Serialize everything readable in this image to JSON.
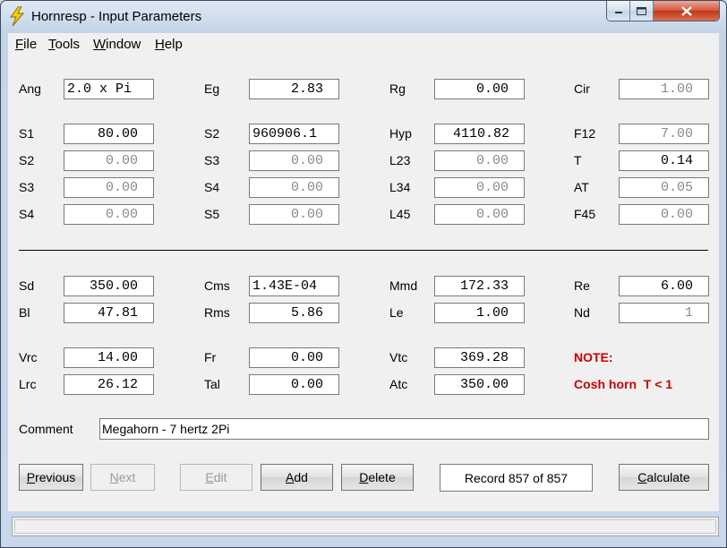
{
  "window": {
    "title": "Hornresp - Input Parameters",
    "accent": "#c8d7ea",
    "close_color": "#c2361a"
  },
  "menu": [
    {
      "acc": "F",
      "rest": "ile"
    },
    {
      "acc": "T",
      "rest": "ools"
    },
    {
      "acc": "W",
      "rest": "indow"
    },
    {
      "acc": "H",
      "rest": "elp"
    }
  ],
  "params": {
    "ang": {
      "label": "Ang",
      "value": "2.0 x Pi"
    },
    "eg": {
      "label": "Eg",
      "value": "2.83"
    },
    "rg": {
      "label": "Rg",
      "value": "0.00"
    },
    "cir": {
      "label": "Cir",
      "value": "1.00"
    },
    "s1": {
      "label": "S1",
      "value": "80.00"
    },
    "s2a": {
      "label": "S2",
      "value": "960906.1"
    },
    "hyp": {
      "label": "Hyp",
      "value": "4110.82"
    },
    "f12": {
      "label": "F12",
      "value": "7.00"
    },
    "s2b": {
      "label": "S2",
      "value": "0.00"
    },
    "s3a": {
      "label": "S3",
      "value": "0.00"
    },
    "l23": {
      "label": "L23",
      "value": "0.00"
    },
    "t": {
      "label": "T",
      "value": "0.14"
    },
    "s3b": {
      "label": "S3",
      "value": "0.00"
    },
    "s4a": {
      "label": "S4",
      "value": "0.00"
    },
    "l34": {
      "label": "L34",
      "value": "0.00"
    },
    "at": {
      "label": "AT",
      "value": "0.05"
    },
    "s4b": {
      "label": "S4",
      "value": "0.00"
    },
    "s5": {
      "label": "S5",
      "value": "0.00"
    },
    "l45": {
      "label": "L45",
      "value": "0.00"
    },
    "f45": {
      "label": "F45",
      "value": "0.00"
    },
    "sd": {
      "label": "Sd",
      "value": "350.00"
    },
    "cms": {
      "label": "Cms",
      "value": "1.43E-04"
    },
    "mmd": {
      "label": "Mmd",
      "value": "172.33"
    },
    "re": {
      "label": "Re",
      "value": "6.00"
    },
    "bl": {
      "label": "Bl",
      "value": "47.81"
    },
    "rms": {
      "label": "Rms",
      "value": "5.86"
    },
    "le": {
      "label": "Le",
      "value": "1.00"
    },
    "nd": {
      "label": "Nd",
      "value": "1"
    },
    "vrc": {
      "label": "Vrc",
      "value": "14.00"
    },
    "fr": {
      "label": "Fr",
      "value": "0.00"
    },
    "vtc": {
      "label": "Vtc",
      "value": "369.28"
    },
    "lrc": {
      "label": "Lrc",
      "value": "26.12"
    },
    "tal": {
      "label": "Tal",
      "value": "0.00"
    },
    "atc": {
      "label": "Atc",
      "value": "350.00"
    }
  },
  "note": {
    "title": "NOTE:",
    "text": "Cosh horn  T < 1",
    "color": "#cc0000"
  },
  "comment": {
    "label": "Comment",
    "value": "Megahorn - 7 hertz 2Pi"
  },
  "buttons": {
    "previous": {
      "acc": "P",
      "rest": "revious"
    },
    "next": {
      "acc": "N",
      "rest": "ext"
    },
    "edit": {
      "acc": "E",
      "rest": "dit"
    },
    "add": {
      "acc": "A",
      "rest": "dd"
    },
    "delete": {
      "acc": "D",
      "rest": "elete"
    },
    "calculate": {
      "acc": "C",
      "rest": "alculate"
    }
  },
  "record": {
    "text": "Record 857 of 857"
  },
  "icons": {
    "app": "lightning-bolt-icon",
    "minimize": "minimize-icon",
    "maximize": "maximize-icon",
    "close": "close-icon"
  }
}
